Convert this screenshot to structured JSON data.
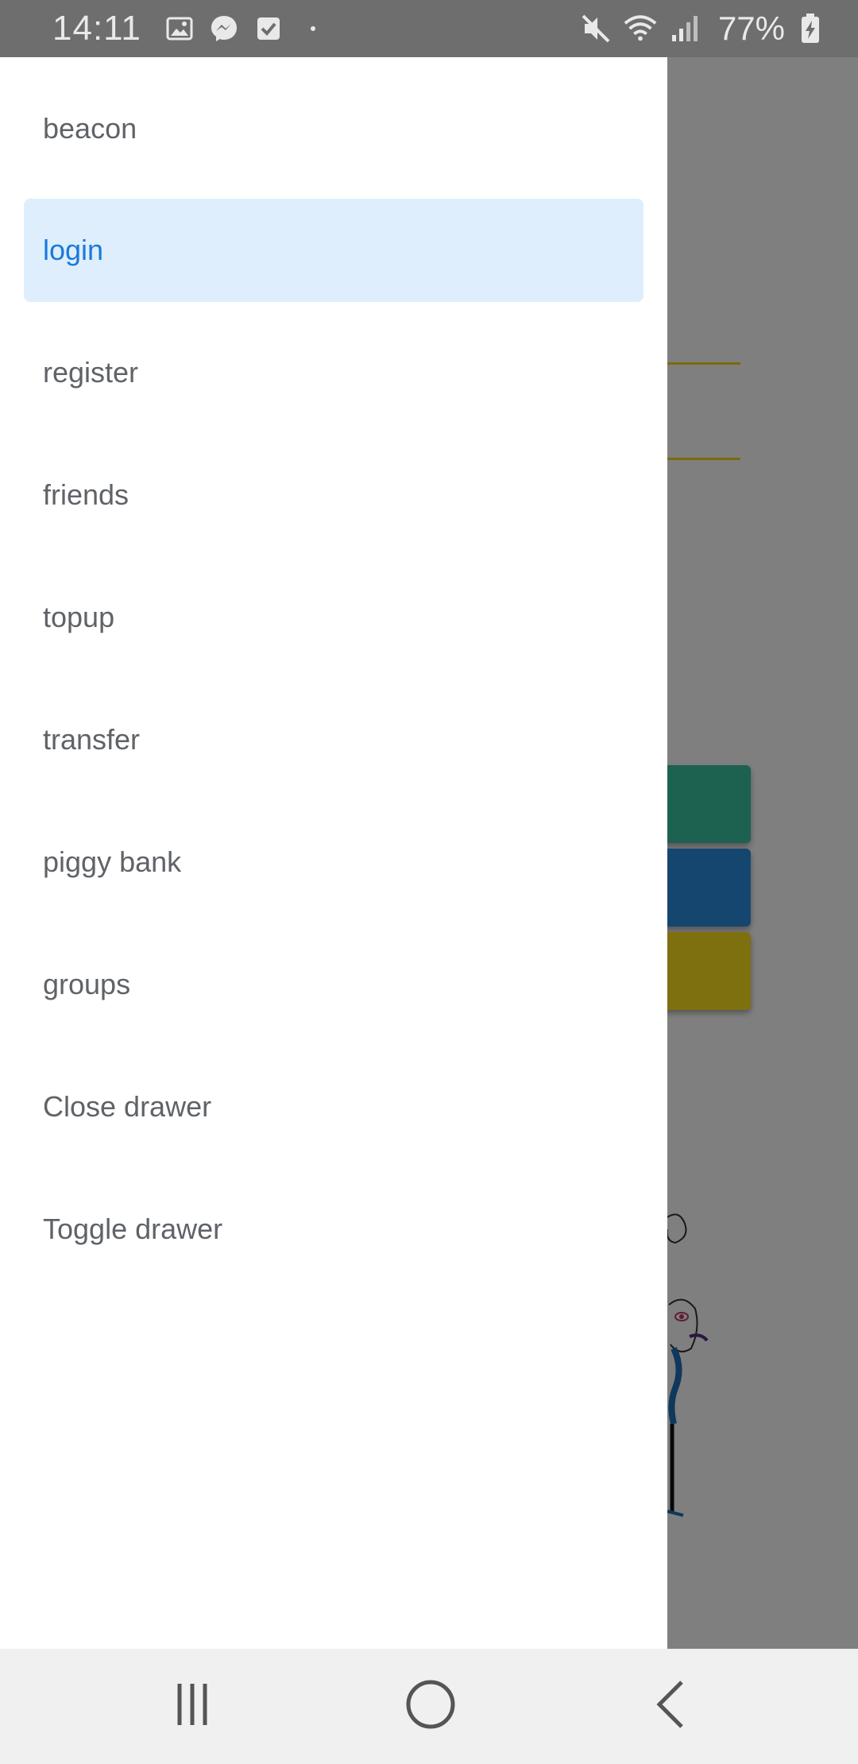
{
  "status_bar": {
    "time": "14:11",
    "battery_percent": "77%",
    "left_icons": [
      "image-icon",
      "messenger-icon",
      "checkbox-icon",
      "dot-icon"
    ],
    "right_icons": [
      "mute-icon",
      "wifi-icon",
      "signal-icon",
      "battery-charging-icon"
    ]
  },
  "drawer": {
    "items": [
      {
        "label": "beacon",
        "active": false
      },
      {
        "label": "login",
        "active": true
      },
      {
        "label": "register",
        "active": false
      },
      {
        "label": "friends",
        "active": false
      },
      {
        "label": "topup",
        "active": false
      },
      {
        "label": "transfer",
        "active": false
      },
      {
        "label": "piggy bank",
        "active": false
      },
      {
        "label": "groups",
        "active": false
      },
      {
        "label": "Close drawer",
        "active": false
      },
      {
        "label": "Toggle drawer",
        "active": false
      }
    ]
  },
  "nav_bar": {
    "buttons": [
      "recent-apps-icon",
      "home-icon",
      "back-icon"
    ]
  },
  "colors": {
    "active_item_bg": "#deeefd",
    "active_item_text": "#1a7ad9",
    "item_text": "#5f6368",
    "accent_yellow": "#f7d51d",
    "button_green": "#3ac3a2",
    "button_blue": "#2a8ce0",
    "button_yellow": "#fce01c"
  }
}
